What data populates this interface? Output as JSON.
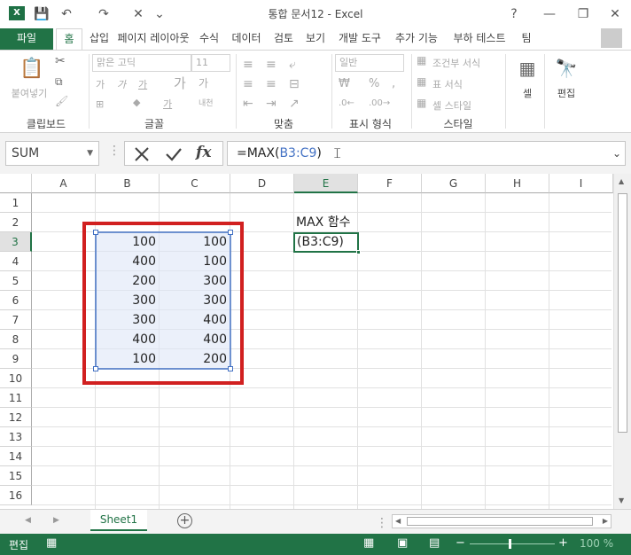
{
  "window": {
    "title": "통합 문서12 - Excel",
    "help": "?",
    "minimize": "—",
    "restore": "❐",
    "close": "✕"
  },
  "quick_access": {
    "logo": "X",
    "save": "💾",
    "undo": "↶",
    "redo": "↷",
    "custom": "✕",
    "more": "⌄"
  },
  "tabs": [
    "파일",
    "홈",
    "삽입",
    "페이지 레이아웃",
    "수식",
    "데이터",
    "검토",
    "보기",
    "개발 도구",
    "추가 기능",
    "부하 테스트",
    "팀"
  ],
  "ribbon": {
    "clipboard": {
      "paste": "붙여넣기",
      "label": "클립보드"
    },
    "font": {
      "font_name": "맑은 고딕",
      "font_size": "11",
      "label": "글꼴"
    },
    "alignment": {
      "label": "맞춤"
    },
    "number": {
      "format": "일반",
      "label": "표시 형식"
    },
    "styles": {
      "conditional": "조건부 서식",
      "table": "표 서식",
      "cell_style": "셀 스타일",
      "label": "스타일"
    },
    "cells": {
      "label": "셀"
    },
    "editing": {
      "label": "편집"
    }
  },
  "formula_bar": {
    "name_box": "SUM",
    "fx": "fx",
    "formula_prefix": "=MAX(",
    "formula_ref": "B3:C9",
    "formula_suffix": ")"
  },
  "grid": {
    "columns": [
      "A",
      "B",
      "C",
      "D",
      "E",
      "F",
      "G",
      "H",
      "I"
    ],
    "rows": [
      "1",
      "2",
      "3",
      "4",
      "5",
      "6",
      "7",
      "8",
      "9",
      "10",
      "11",
      "12",
      "13",
      "14",
      "15",
      "16"
    ],
    "e2_label": "MAX 함수",
    "active_cell_text": "(B3:C9)",
    "col_b": [
      "100",
      "400",
      "200",
      "300",
      "300",
      "400",
      "100"
    ],
    "col_c": [
      "100",
      "100",
      "300",
      "300",
      "400",
      "400",
      "200"
    ]
  },
  "sheets": {
    "active": "Sheet1",
    "add": "+"
  },
  "status": {
    "mode": "편집",
    "zoom": "100 %"
  },
  "colors": {
    "excel_green": "#217346",
    "highlight_red": "#d12020",
    "ref_blue": "#4472c4"
  }
}
